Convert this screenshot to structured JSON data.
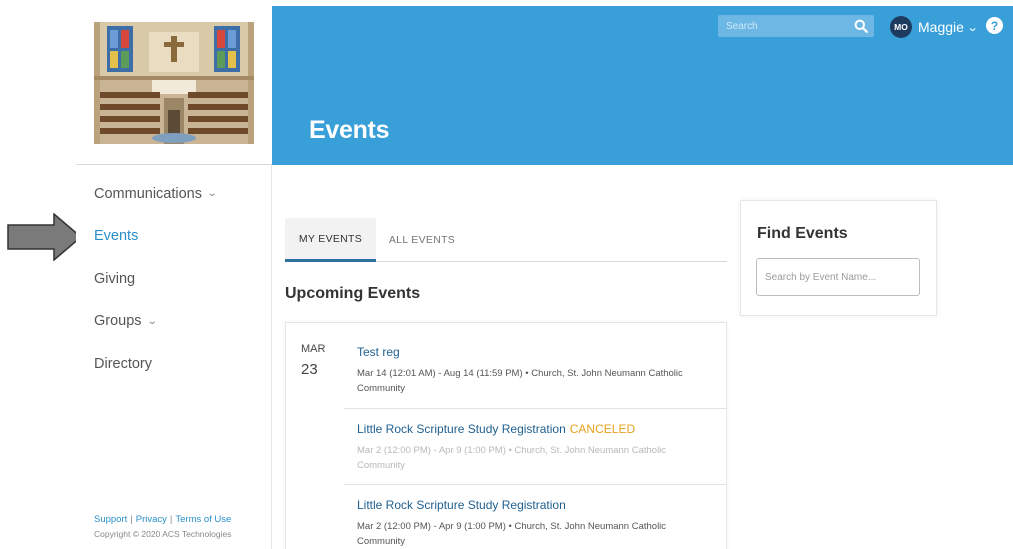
{
  "colors": {
    "header": "#399fd8",
    "active_nav": "#2a8fc9",
    "link": "#1f5f8f",
    "canceled": "#e8a21d",
    "avatar": "#1d3a5f"
  },
  "header": {
    "title": "Events",
    "search_placeholder": "Search",
    "user": {
      "initials": "MO",
      "name": "Maggie"
    },
    "help_glyph": "?"
  },
  "sidebar": {
    "items": [
      {
        "label": "Communications",
        "has_chevron": true,
        "active": false
      },
      {
        "label": "Events",
        "has_chevron": false,
        "active": true
      },
      {
        "label": "Giving",
        "has_chevron": false,
        "active": false
      },
      {
        "label": "Groups",
        "has_chevron": true,
        "active": false
      },
      {
        "label": "Directory",
        "has_chevron": false,
        "active": false
      }
    ],
    "footer": {
      "support": "Support",
      "privacy": "Privacy",
      "terms": "Terms of Use",
      "copyright": "Copyright © 2020 ACS Technologies"
    }
  },
  "tabs": [
    {
      "label": "MY EVENTS",
      "selected": true
    },
    {
      "label": "ALL EVENTS",
      "selected": false
    }
  ],
  "section_heading": "Upcoming Events",
  "event_group": {
    "month": "MAR",
    "day": "23",
    "events": [
      {
        "title": "Test reg",
        "status": "",
        "meta": "Mar 14 (12:01 AM) - Aug 14 (11:59 PM) • Church, St. John Neumann Catholic Community"
      },
      {
        "title": "Little Rock Scripture Study Registration",
        "status": "CANCELED",
        "meta": "Mar 2 (12:00 PM) - Apr 9 (1:00 PM) • Church, St. John Neumann Catholic Community"
      },
      {
        "title": "Little Rock Scripture Study Registration",
        "status": "",
        "meta": "Mar 2 (12:00 PM) - Apr 9 (1:00 PM) • Church, St. John Neumann Catholic Community"
      }
    ]
  },
  "find_events": {
    "title": "Find Events",
    "placeholder": "Search by Event Name..."
  },
  "icons": [
    "search-icon",
    "chevron-down-icon",
    "help-icon",
    "arrow-pointer-icon",
    "church-photo"
  ]
}
